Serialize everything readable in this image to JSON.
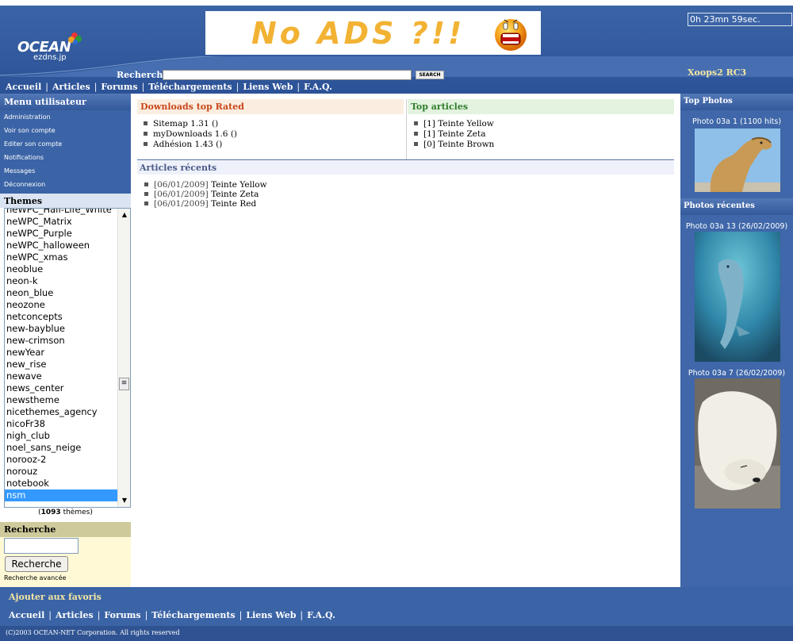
{
  "header": {
    "logo_text": "OCEAN",
    "logo_sub": "ezdns.jp",
    "banner_text": "No ADS ?!!",
    "timer": "0h 23mn 59sec.",
    "version": "Xoops2 RC3",
    "search_label": "Recherche",
    "search_button": "SEARCH",
    "nav": [
      "Accueil",
      "Articles",
      "Forums",
      "Téléchargements",
      "Liens Web",
      "F.A.Q."
    ]
  },
  "left": {
    "user_menu_title": "Menu utilisateur",
    "user_menu": [
      "Administration",
      "Voir son compte",
      "Editer son compte",
      "Notifications",
      "Messages",
      "Déconnexion"
    ],
    "themes_title": "Themes",
    "themes": [
      "neWPC_Half-Life_White",
      "neWPC_Matrix",
      "neWPC_Purple",
      "neWPC_halloween",
      "neWPC_xmas",
      "neoblue",
      "neon-k",
      "neon_blue",
      "neozone",
      "netconcepts",
      "new-bayblue",
      "new-crimson",
      "newYear",
      "new_rise",
      "newave",
      "news_center",
      "newstheme",
      "nicethemes_agency",
      "nicoFr38",
      "nigh_club",
      "noel_sans_neige",
      "norooz-2",
      "norouz",
      "notebook",
      "nsm"
    ],
    "selected_theme": "nsm",
    "themes_count_num": "1093",
    "themes_count_label": "thèmes",
    "search_title": "Recherche",
    "search_button": "Recherche",
    "advanced_search": "Recherche avancée"
  },
  "center": {
    "downloads": {
      "title": "Downloads top Rated",
      "items": [
        {
          "name": "Sitemap 1.31",
          "extra": "()"
        },
        {
          "name": "myDownloads 1.6",
          "extra": "()"
        },
        {
          "name": "Adhésion 1.43",
          "extra": "()"
        }
      ]
    },
    "top_articles": {
      "title": "Top articles",
      "items": [
        {
          "count": "[1]",
          "name": "Teinte Yellow"
        },
        {
          "count": "[1]",
          "name": "Teinte Zeta"
        },
        {
          "count": "[0]",
          "name": "Teinte Brown"
        }
      ]
    },
    "recent_articles": {
      "title": "Articles récents",
      "items": [
        {
          "date": "[06/01/2009]",
          "name": "Teinte Yellow"
        },
        {
          "date": "[06/01/2009]",
          "name": "Teinte Zeta"
        },
        {
          "date": "[06/01/2009]",
          "name": "Teinte Red"
        }
      ]
    }
  },
  "right": {
    "top_photos_title": "Top Photos",
    "top_photo_caption": "Photo 03a 1 (1100 hits)",
    "recent_photos_title": "Photos récentes",
    "recent_photo1_caption": "Photo 03a 13 (26/02/2009)",
    "recent_photo2_caption": "Photo 03a 7 (26/02/2009)"
  },
  "footer": {
    "favorites": "Ajouter aux favoris",
    "nav": [
      "Accueil",
      "Articles",
      "Forums",
      "Téléchargements",
      "Liens Web",
      "F.A.Q."
    ],
    "copyright": "(C)2003 OCEAN-NET Corporation. All rights reserved"
  },
  "colors": {
    "header_blue": "#3b64a6",
    "accent_yellow": "#f3e7a3",
    "downloads_title": "#c9461a",
    "top_articles_title": "#2f7d2a",
    "selected_theme": "#3399ff"
  }
}
